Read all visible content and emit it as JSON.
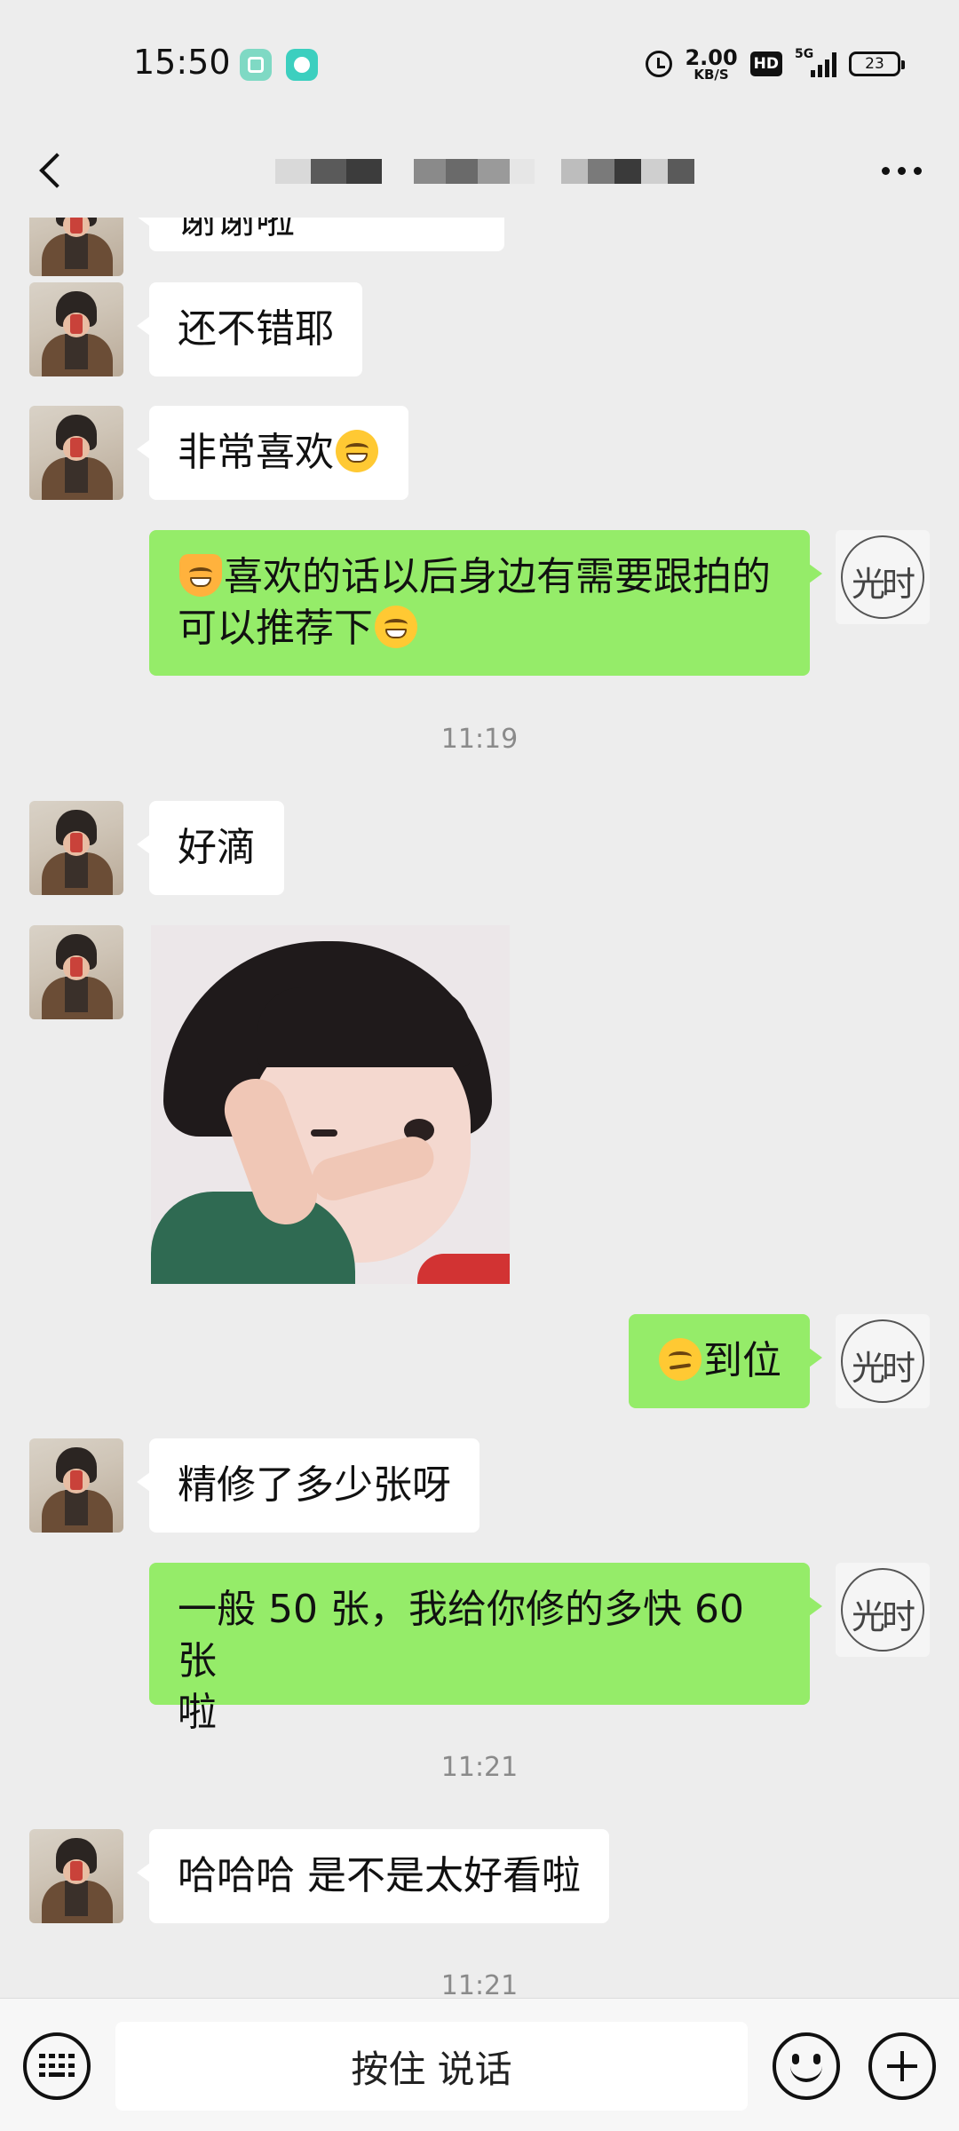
{
  "status_bar": {
    "time": "15:50",
    "net_speed_value": "2.00",
    "net_speed_unit": "KB/S",
    "hd_label": "HD",
    "network_label": "5G",
    "battery_level": "23"
  },
  "header": {
    "title": "",
    "title_redacted": true
  },
  "messages": [
    {
      "side": "left",
      "type": "text",
      "text": "谢谢啦"
    },
    {
      "side": "left",
      "type": "text",
      "text": "还不错耶"
    },
    {
      "side": "left",
      "type": "text",
      "text": "非常喜欢",
      "emoji_after": "laugh-cry-emoji"
    },
    {
      "side": "right",
      "type": "text",
      "emoji_before": "cat-emoji",
      "line1": "喜欢的话以后身边有需要跟拍的",
      "line2": "可以推荐下",
      "emoji_after": "grin-emoji"
    },
    {
      "type": "timestamp",
      "text": "11:19"
    },
    {
      "side": "left",
      "type": "text",
      "text": "好滴"
    },
    {
      "side": "left",
      "type": "sticker",
      "icon": "child-pointing-sticker"
    },
    {
      "side": "right",
      "type": "text",
      "emoji_before": "smirk-emoji",
      "text": "到位"
    },
    {
      "side": "left",
      "type": "text",
      "text": "精修了多少张呀"
    },
    {
      "side": "right",
      "type": "text",
      "line1": "一般 50 张，我给你修的多快 60 张",
      "line2": "啦"
    },
    {
      "type": "timestamp",
      "text": "11:21"
    },
    {
      "side": "left",
      "type": "text",
      "text": "哈哈哈 是不是太好看啦"
    },
    {
      "type": "timestamp",
      "text": "11:21"
    }
  ],
  "input_bar": {
    "voice_button_label": "按住 说话"
  },
  "colors": {
    "background": "#ededed",
    "sent_bubble": "#95ec69",
    "received_bubble": "#ffffff",
    "timestamp": "#8a8a8a"
  }
}
